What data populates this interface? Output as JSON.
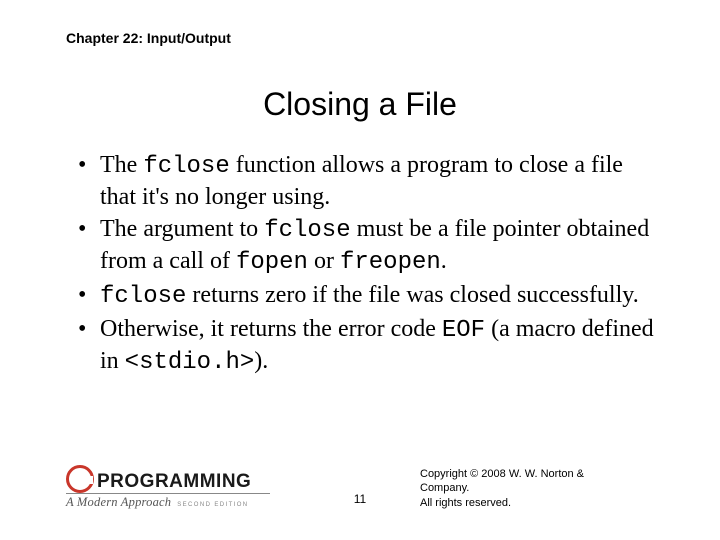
{
  "chapter": "Chapter 22: Input/Output",
  "title": "Closing a File",
  "bullets": [
    {
      "pre": "The ",
      "code1": "fclose",
      "mid1": " function allows a program to close a file that it's no longer using.",
      "code2": "",
      "mid2": "",
      "code3": "",
      "tail": ""
    },
    {
      "pre": "The argument to ",
      "code1": "fclose",
      "mid1": " must be a file pointer obtained from a call of ",
      "code2": "fopen",
      "mid2": " or ",
      "code3": "freopen",
      "tail": "."
    },
    {
      "pre": "",
      "code1": "fclose",
      "mid1": " returns zero if the file was closed successfully.",
      "code2": "",
      "mid2": "",
      "code3": "",
      "tail": ""
    },
    {
      "pre": "Otherwise, it returns the error code ",
      "code1": "EOF",
      "mid1": " (a macro defined in ",
      "code2": "<stdio.h>",
      "mid2": ").",
      "code3": "",
      "tail": ""
    }
  ],
  "page_number": "11",
  "logo": {
    "word": "PROGRAMMING",
    "sub": "A Modern Approach",
    "edition": "SECOND EDITION"
  },
  "copyright_line1": "Copyright © 2008 W. W. Norton & Company.",
  "copyright_line2": "All rights reserved."
}
